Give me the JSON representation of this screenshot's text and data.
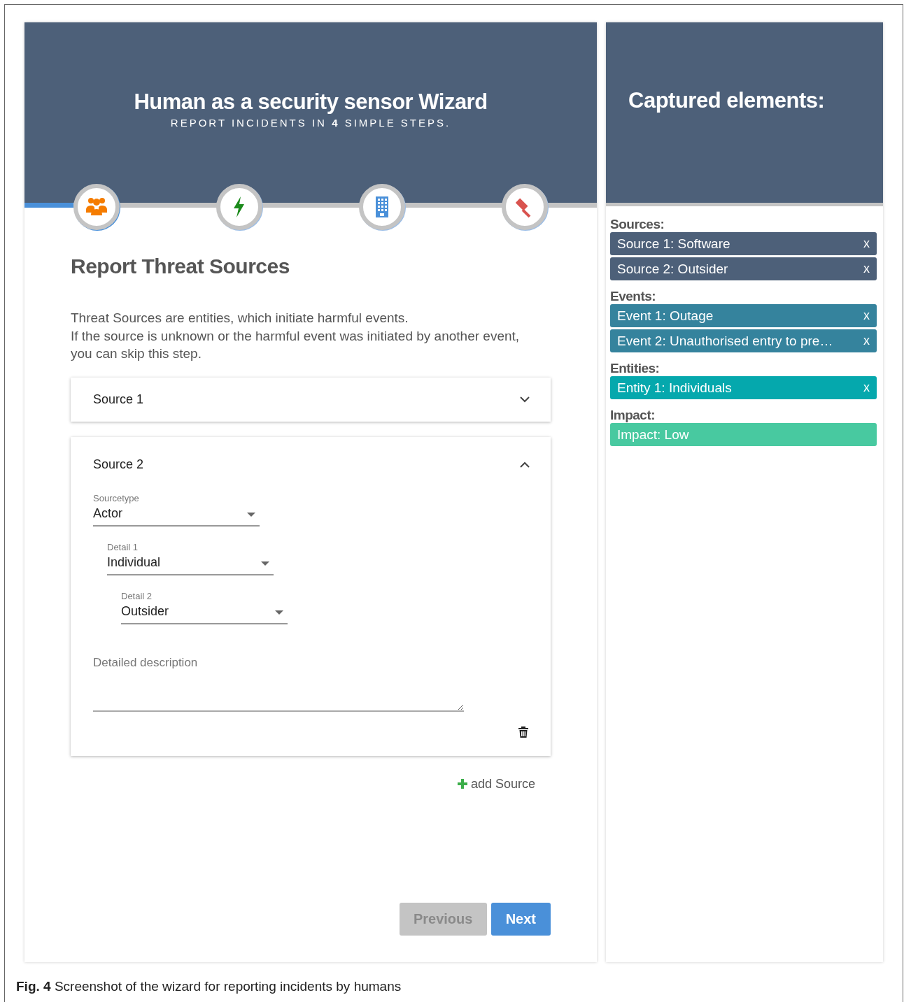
{
  "wizard": {
    "title": "Human as a security sensor Wizard",
    "subtitle": "REPORT INCIDENTS IN **4** SIMPLE STEPS.",
    "steps": [
      {
        "selected": true
      },
      {
        "selected": false
      },
      {
        "selected": false
      },
      {
        "selected": false
      }
    ],
    "heading": "Report Threat Sources",
    "intro": [
      "Threat Sources are entities, which initiate harmful events.",
      "If the source is unknown or the harmful event was initiated by another event, you can skip this step."
    ],
    "panels": [
      {
        "title": "Source 1",
        "expanded": false
      },
      {
        "title": "Source 2",
        "expanded": true,
        "fields": [
          {
            "label": "Sourcetype",
            "value": "Actor"
          },
          {
            "label": "Detail 1",
            "value": "Individual"
          },
          {
            "label": "Detail 2",
            "value": "Outsider"
          }
        ],
        "description": {
          "placeholder": "Detailed description"
        }
      }
    ],
    "add_button": "add Source",
    "buttons": [
      {
        "label": "Previous",
        "disabled": true
      },
      {
        "label": "Next",
        "disabled": false
      }
    ]
  },
  "captured": {
    "title": "Captured elements:",
    "sections": [
      {
        "label": "Sources:",
        "color": "#4d6079",
        "items": [
          {
            "text": "Source 1: Software",
            "remove": "x"
          },
          {
            "text": "Source 2: Outsider",
            "remove": "x"
          }
        ]
      },
      {
        "label": "Events:",
        "color": "#35839d",
        "items": [
          {
            "text": "Event 1: Outage",
            "remove": "x"
          },
          {
            "text": "Event 2: Unauthorised entry to pre…",
            "remove": "x"
          }
        ]
      },
      {
        "label": "Entities:",
        "color": "#05a8ad",
        "items": [
          {
            "text": "Entity 1: Individuals",
            "remove": "x"
          }
        ]
      },
      {
        "label": "Impact:",
        "color": "#48c9a0",
        "items": [
          {
            "text": "Impact: Low"
          }
        ]
      }
    ]
  },
  "caption": "**Fig. 4** Screenshot of the wizard for reporting incidents by humans"
}
